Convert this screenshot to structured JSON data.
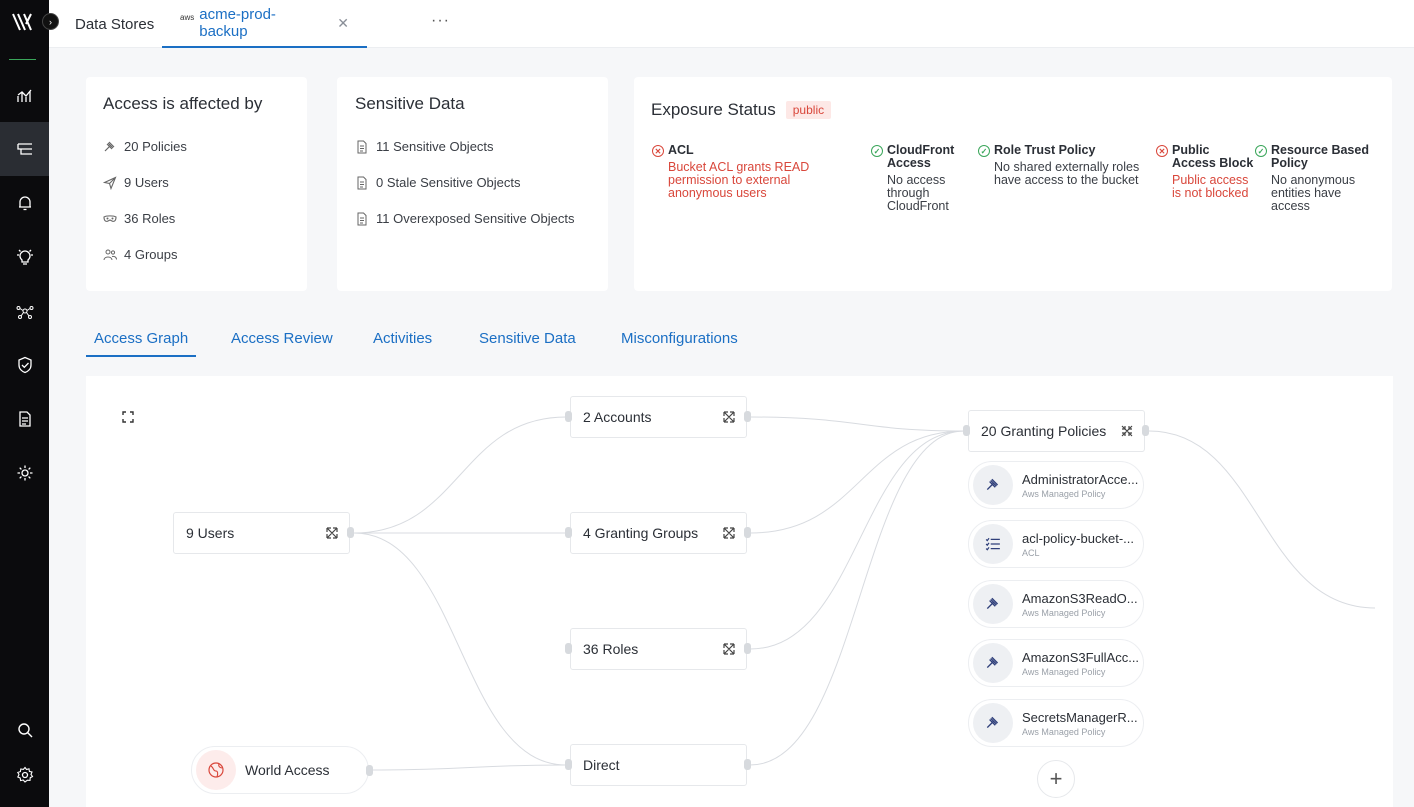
{
  "tabs": {
    "data_stores": "Data Stores",
    "aws_badge": "aws",
    "current": "acme-prod-backup",
    "close": "✕",
    "more": "···"
  },
  "access_card": {
    "title": "Access is affected by",
    "items": [
      {
        "label": "20 Policies",
        "icon": "gavel-icon"
      },
      {
        "label": "9 Users",
        "icon": "send-icon"
      },
      {
        "label": "36 Roles",
        "icon": "mask-icon"
      },
      {
        "label": "4 Groups",
        "icon": "group-icon"
      }
    ]
  },
  "sensitive_card": {
    "title": "Sensitive Data",
    "items": [
      {
        "label": "11 Sensitive Objects"
      },
      {
        "label": "0 Stale Sensitive Objects"
      },
      {
        "label": "11 Overexposed Sensitive Objects"
      }
    ]
  },
  "exposure": {
    "title": "Exposure Status",
    "badge": "public",
    "items": [
      {
        "title": "ACL",
        "desc": "Bucket ACL grants READ permission to external anonymous users",
        "status": "bad"
      },
      {
        "title": "CloudFront Access",
        "desc": "No access through CloudFront",
        "status": "ok"
      },
      {
        "title": "Role Trust Policy",
        "desc": "No shared externally roles have access to the bucket",
        "status": "ok"
      },
      {
        "title": "Public Access Block",
        "desc": "Public access is not blocked",
        "status": "bad"
      },
      {
        "title": "Resource Based Policy",
        "desc": "No anonymous entities have access",
        "status": "ok"
      }
    ]
  },
  "content_tabs": [
    "Access Graph",
    "Access Review",
    "Activities",
    "Sensitive Data",
    "Misconfigurations"
  ],
  "graph": {
    "users": "9 Users",
    "world": "World Access",
    "accounts": "2 Accounts",
    "groups": "4 Granting Groups",
    "roles": "36 Roles",
    "direct": "Direct",
    "granting": "20 Granting Policies",
    "policies": [
      {
        "name": "AdministratorAcce...",
        "type": "Aws Managed Policy",
        "icon": "gavel-icon"
      },
      {
        "name": "acl-policy-bucket-...",
        "type": "ACL",
        "icon": "list-icon"
      },
      {
        "name": "AmazonS3ReadO...",
        "type": "Aws Managed Policy",
        "icon": "gavel-icon"
      },
      {
        "name": "AmazonS3FullAcc...",
        "type": "Aws Managed Policy",
        "icon": "gavel-icon"
      },
      {
        "name": "SecretsManagerR...",
        "type": "Aws Managed Policy",
        "icon": "gavel-icon"
      }
    ],
    "add": "+"
  },
  "colors": {
    "accent": "#1b6fc4",
    "danger": "#d9473b",
    "ok": "#3aa65a"
  }
}
